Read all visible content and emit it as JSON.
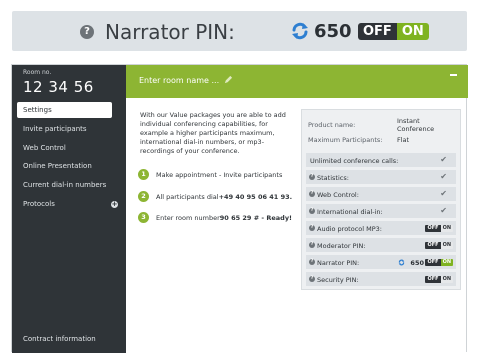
{
  "zoom": {
    "help_glyph": "?",
    "label": "Narrator PIN:",
    "pin": "650",
    "toggle_off": "OFF",
    "toggle_on": "ON"
  },
  "header": {
    "room_no_label": "Room no.",
    "room_number": "12 34 56",
    "room_name_placeholder": "Enter room name ..."
  },
  "sidebar": {
    "items": [
      "Settings",
      "Invite participants",
      "Web Control",
      "Online Presentation",
      "Current dial-in numbers",
      "Protocols"
    ],
    "footer": "Contract information"
  },
  "main": {
    "intro": "With our Value packages you are able to add individual conferencing capabilities, for example a higher participants maximum, international dial-in numbers, or mp3-recordings of your conference.",
    "steps": [
      {
        "n": "1",
        "text": "Make appointment - Invite participants",
        "bold": ""
      },
      {
        "n": "2",
        "text": "All participants dial ",
        "bold": "+49 40 95 06 41 93."
      },
      {
        "n": "3",
        "text": "Enter room number ",
        "bold": "90 65 29 # - Ready!"
      }
    ]
  },
  "panel": {
    "product_label": "Product name:",
    "product_value": "Instant Conference",
    "max_label": "Maximum Participants:",
    "max_value": "Flat",
    "features": [
      {
        "label": "Unlimited conference calls:",
        "kind": "check"
      },
      {
        "label": "Statistics:",
        "kind": "check"
      },
      {
        "label": "Web Control:",
        "kind": "check"
      },
      {
        "label": "International dial-in:",
        "kind": "check"
      },
      {
        "label": "Audio protocol MP3:",
        "kind": "toggle"
      },
      {
        "label": "Moderator PIN:",
        "kind": "toggle"
      },
      {
        "label": "Narrator PIN:",
        "kind": "toggle-active",
        "pin": "650"
      },
      {
        "label": "Security PIN:",
        "kind": "toggle"
      }
    ],
    "toggle_off": "OFF",
    "toggle_on": "ON",
    "check_glyph": "✔",
    "help_glyph": "?"
  },
  "colors": {
    "accent": "#8db533",
    "dark": "#2f3438",
    "toggle_on": "#7fb321",
    "sync_blue": "#2e7fd1"
  }
}
